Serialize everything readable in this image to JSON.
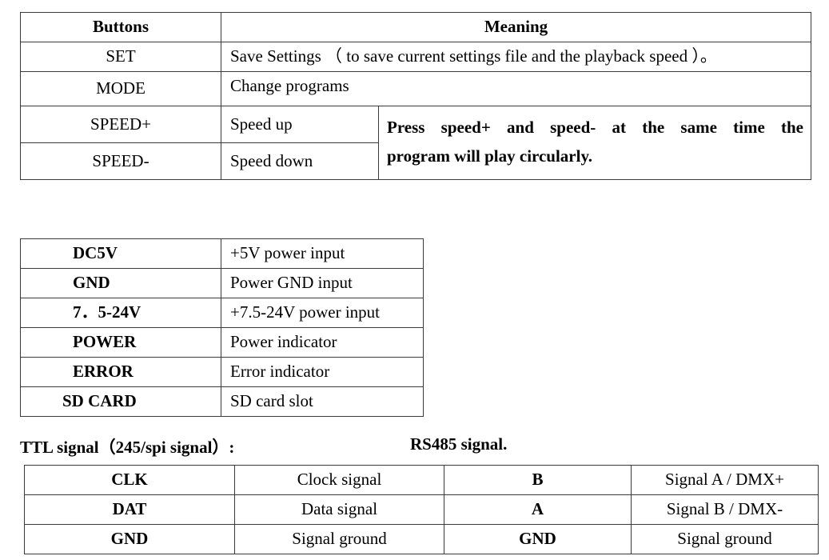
{
  "buttons_table": {
    "headers": [
      "Buttons",
      "Meaning"
    ],
    "rows": [
      {
        "button": "SET",
        "meaning": "Save Settings （ to save current settings file and the playback speed ）。"
      },
      {
        "button": "MODE",
        "meaning": "Change programs"
      },
      {
        "button": "SPEED+",
        "meaning": "Speed up"
      },
      {
        "button": "SPEED-",
        "meaning": "Speed down"
      }
    ],
    "speed_note_line1": "Press speed+ and speed- at the same time the",
    "speed_note_line2": "program will play circularly."
  },
  "ports_table": {
    "rows": [
      {
        "port": "DC5V",
        "meaning": "+5V power input"
      },
      {
        "port": "GND",
        "meaning": "Power GND input"
      },
      {
        "port": "7．5-24V",
        "meaning": "+7.5-24V power input"
      },
      {
        "port": "POWER",
        "meaning": "Power indicator"
      },
      {
        "port": "ERROR",
        "meaning": "Error indicator"
      },
      {
        "port": "SD CARD",
        "meaning": "SD card slot"
      }
    ]
  },
  "headings": {
    "ttl": "TTL signal（245/spi signal）:",
    "rs485": "RS485 signal."
  },
  "signal_table": {
    "rows": [
      {
        "ttl_pin": "CLK",
        "ttl_meaning": "Clock signal",
        "rs485_pin": "B",
        "rs485_meaning": "Signal A / DMX+"
      },
      {
        "ttl_pin": "DAT",
        "ttl_meaning": "Data signal",
        "rs485_pin": "A",
        "rs485_meaning": "Signal B / DMX-"
      },
      {
        "ttl_pin": "GND",
        "ttl_meaning": "Signal ground",
        "rs485_pin": "GND",
        "rs485_meaning": "Signal ground"
      }
    ]
  }
}
